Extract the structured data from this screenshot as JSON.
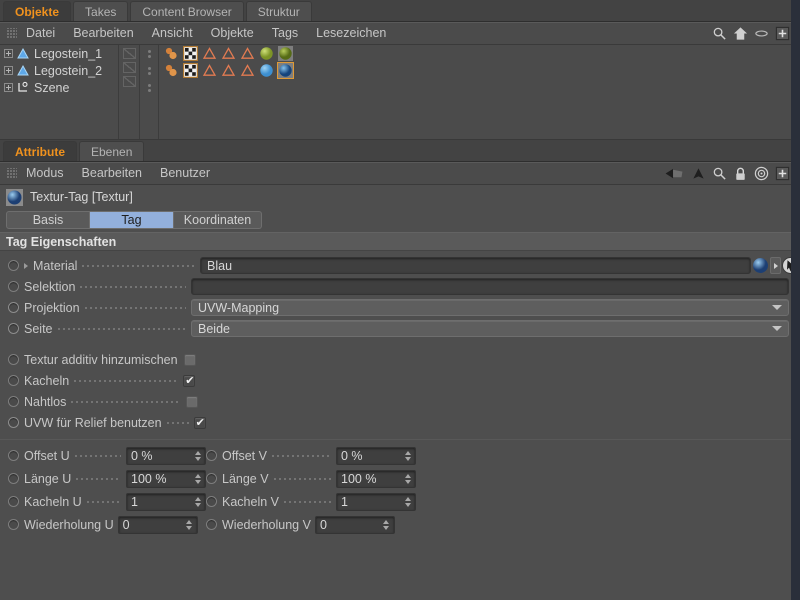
{
  "window": {
    "accent_orange": "#f0921e",
    "panel_bg": "#4e4e4e",
    "tab_active_bg": "#93b0dc"
  },
  "object_manager": {
    "tabs": [
      {
        "label": "Objekte",
        "active": true
      },
      {
        "label": "Takes",
        "active": false
      },
      {
        "label": "Content Browser",
        "active": false
      },
      {
        "label": "Struktur",
        "active": false
      }
    ],
    "menu": [
      "Datei",
      "Bearbeiten",
      "Ansicht",
      "Objekte",
      "Tags",
      "Lesezeichen"
    ],
    "tool_icons": [
      "search-icon",
      "home-icon",
      "eye-icon",
      "plus-box-icon"
    ],
    "rows": [
      {
        "name": "Legostein_1",
        "icon": "polygon-object-icon",
        "tags": [
          "phong-tag-icon",
          "uv-checker-tag-icon",
          "selection-tag-icon",
          "selection-tag-icon",
          "selection-tag-icon",
          "material-tag-green",
          "material-tag-green"
        ],
        "selected_tag_index": -1
      },
      {
        "name": "Legostein_2",
        "icon": "polygon-object-icon",
        "tags": [
          "phong-tag-icon",
          "uv-checker-tag-icon",
          "selection-tag-icon",
          "selection-tag-icon",
          "selection-tag-icon",
          "material-tag-blue",
          "material-tag-blue"
        ],
        "selected_tag_index": 6
      },
      {
        "name": "Szene",
        "icon": "layer-object-icon",
        "tags": [],
        "selected_tag_index": -1
      }
    ]
  },
  "attribute_manager": {
    "tabs": [
      {
        "label": "Attribute",
        "active": true
      },
      {
        "label": "Ebenen",
        "active": false
      }
    ],
    "menu": [
      "Modus",
      "Bearbeiten",
      "Benutzer"
    ],
    "tool_icons": [
      "back-arrow-icon",
      "up-arrow-icon",
      "search-icon",
      "lock-icon",
      "target-icon",
      "plus-box-icon"
    ],
    "object_title": "Textur-Tag [Textur]",
    "object_title_icon": "material-sphere-icon",
    "tag_tabs": [
      {
        "label": "Basis",
        "active": false
      },
      {
        "label": "Tag",
        "active": true
      },
      {
        "label": "Koordinaten",
        "active": false
      }
    ],
    "section_header": "Tag Eigenschaften",
    "properties": [
      {
        "label": "Material",
        "type": "link",
        "value": "Blau",
        "has_expand_arrow": true,
        "trailing_icons": [
          "material-sphere-icon",
          "small-right-arrow",
          "pick-cursor-icon"
        ]
      },
      {
        "label": "Selektion",
        "type": "input",
        "value": "",
        "has_expand_arrow": false
      },
      {
        "label": "Projektion",
        "type": "dropdown",
        "value": "UVW-Mapping",
        "has_expand_arrow": false
      },
      {
        "label": "Seite",
        "type": "dropdown",
        "value": "Beide",
        "has_expand_arrow": false
      }
    ],
    "checkboxes": [
      {
        "label": "Textur additiv hinzumischen",
        "checked": false,
        "dots": false
      },
      {
        "label": "Kacheln",
        "checked": true,
        "dots": true
      },
      {
        "label": "Nahtlos",
        "checked": false,
        "dots": true
      },
      {
        "label": "UVW für Relief benutzen",
        "checked": true,
        "dots": true
      }
    ],
    "numeric_rows": [
      {
        "left": {
          "label": "Offset U",
          "value": "0 %",
          "dots": true
        },
        "right": {
          "label": "Offset V",
          "value": "0 %",
          "dots": true
        }
      },
      {
        "left": {
          "label": "Länge U",
          "value": "100 %",
          "dots": true
        },
        "right": {
          "label": "Länge V",
          "value": "100 %",
          "dots": true
        }
      },
      {
        "left": {
          "label": "Kacheln U",
          "value": "1",
          "dots": true
        },
        "right": {
          "label": "Kacheln V",
          "value": "1",
          "dots": true
        }
      },
      {
        "left": {
          "label": "Wiederholung U",
          "value": "0",
          "dots": false
        },
        "right": {
          "label": "Wiederholung V",
          "value": "0",
          "dots": false
        }
      }
    ]
  }
}
